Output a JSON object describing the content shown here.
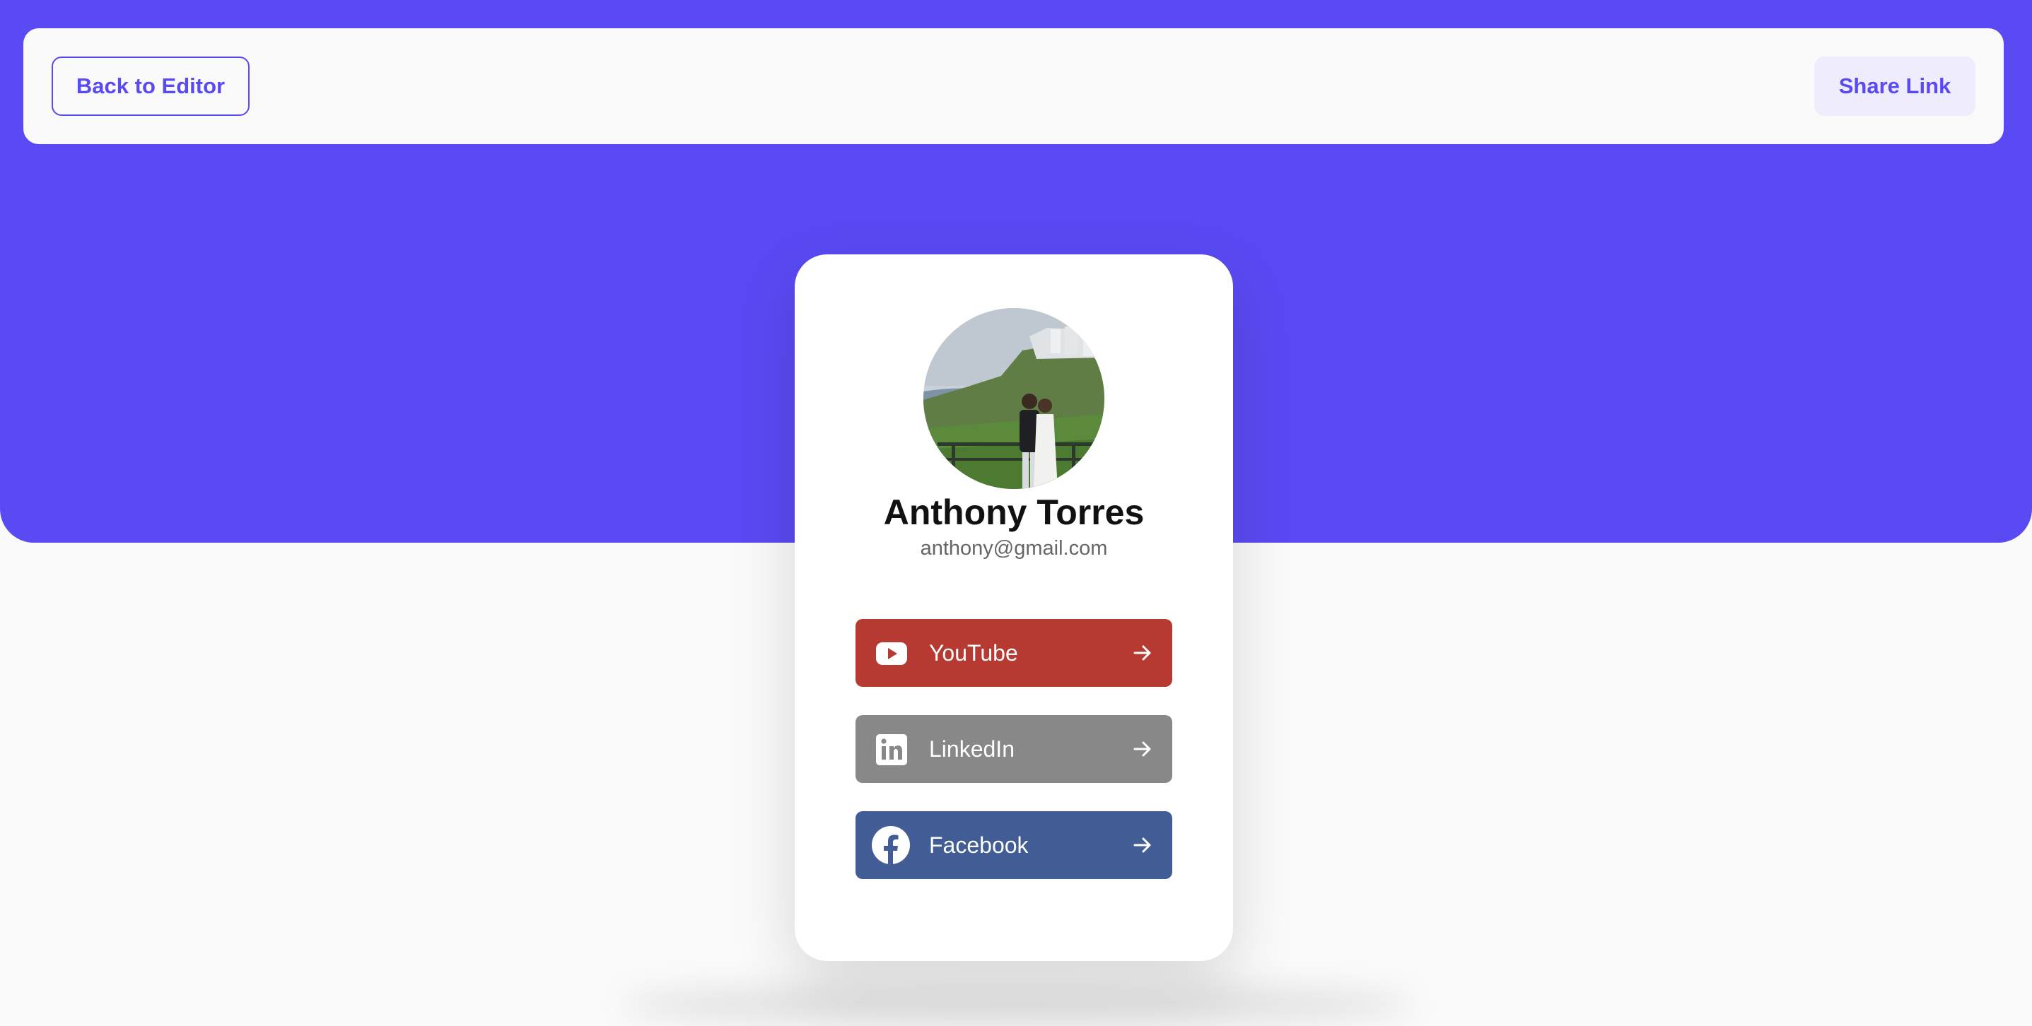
{
  "theme": {
    "accent": "#5a4af4",
    "background": "#fafafa",
    "card": "#ffffff"
  },
  "toolbar": {
    "back_label": "Back to Editor",
    "share_label": "Share Link"
  },
  "profile": {
    "name": "Anthony Torres",
    "email": "anthony@gmail.com",
    "avatar": "profile-photo"
  },
  "links": [
    {
      "label": "YouTube",
      "icon": "youtube-icon",
      "color": "#b73a32"
    },
    {
      "label": "LinkedIn",
      "icon": "linkedin-icon",
      "color": "#888888"
    },
    {
      "label": "Facebook",
      "icon": "facebook-icon",
      "color": "#425c96"
    }
  ]
}
